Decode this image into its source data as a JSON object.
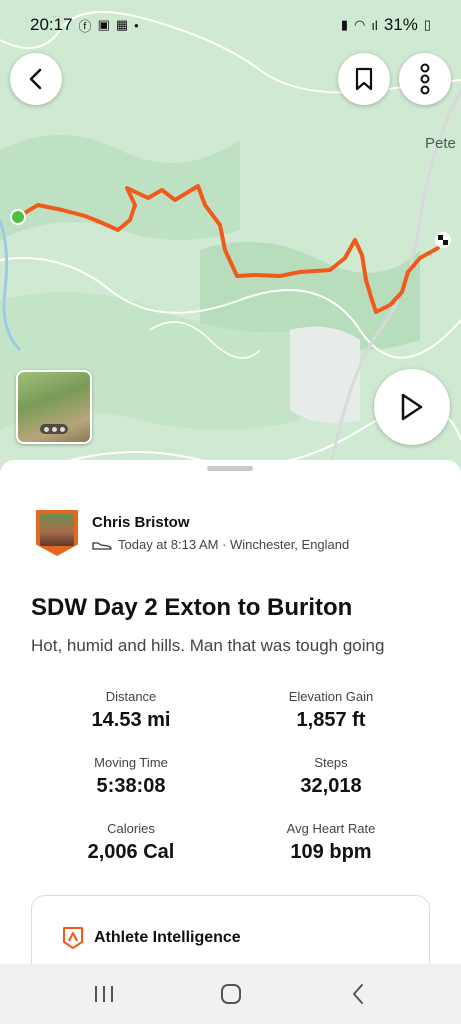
{
  "status_bar": {
    "time": "20:17",
    "battery": "31%",
    "icons": [
      "facebook-icon",
      "teams-icon",
      "calendar-icon",
      "dot-icon",
      "battery-saver-icon",
      "wifi-icon",
      "signal-icon",
      "battery-icon"
    ]
  },
  "map": {
    "place_label": "Pete",
    "route_color": "#f25a1a",
    "start_marker_color": "#4cc33e"
  },
  "map_controls": {
    "back": "back-arrow-icon",
    "save": "bookmark-icon",
    "more": "more-vertical-icon",
    "play": "play-icon"
  },
  "athlete": {
    "name": "Chris Bristow",
    "meta": "Today at 8:13 AM · Winchester, England",
    "activity_icon": "shoe-icon"
  },
  "activity": {
    "title": "SDW Day 2 Exton to Buriton",
    "description": "Hot, humid and hills. Man that was tough going"
  },
  "stats": [
    {
      "label": "Distance",
      "value": "14.53 mi"
    },
    {
      "label": "Elevation Gain",
      "value": "1,857 ft"
    },
    {
      "label": "Moving Time",
      "value": "5:38:08"
    },
    {
      "label": "Steps",
      "value": "32,018"
    },
    {
      "label": "Calories",
      "value": "2,006 Cal"
    },
    {
      "label": "Avg Heart Rate",
      "value": "109 bpm"
    }
  ],
  "ai_card": {
    "title": "Athlete Intelligence",
    "icon": "athlete-intelligence-icon"
  },
  "nav_bar": {
    "items": [
      "recents-icon",
      "home-icon",
      "back-icon"
    ]
  },
  "colors": {
    "accent": "#f25a1a",
    "map_base": "#cfe9d2"
  }
}
